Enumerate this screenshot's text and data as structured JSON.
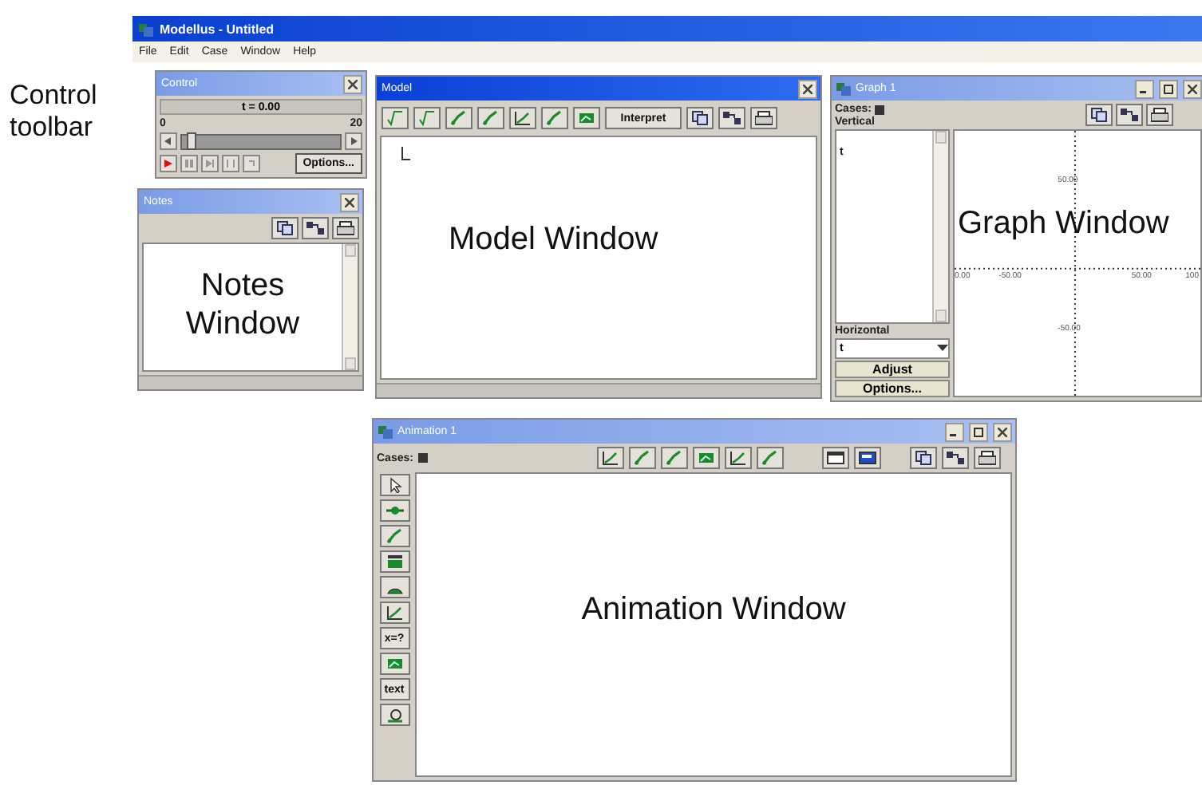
{
  "annotation": "Control toolbar",
  "app": {
    "title": "Modellus - Untitled",
    "menu": [
      "File",
      "Edit",
      "Case",
      "Window",
      "Help"
    ]
  },
  "control": {
    "title": "Control",
    "active": false,
    "readout": "t = 0.00",
    "slider": {
      "min": "0",
      "max": "20",
      "level": 0.03
    },
    "options": "Options..."
  },
  "notes": {
    "title": "Notes",
    "active": false,
    "caption": "Notes Window"
  },
  "model": {
    "title": "Model",
    "active": true,
    "interpret": "Interpret",
    "caption": "Model Window"
  },
  "graph": {
    "title": "Graph 1",
    "active": false,
    "cases": "Cases:",
    "vertical": "Vertical",
    "vertical_items": [
      "t"
    ],
    "horizontal": "Horizontal",
    "horizontal_value": "t",
    "adjust": "Adjust",
    "options": "Options...",
    "caption": "Graph Window",
    "y_ticks": [
      "50.00",
      "-50.00"
    ],
    "x_ticks": [
      "0.00",
      "-50.00",
      "50.00",
      "100"
    ]
  },
  "animation": {
    "title": "Animation 1",
    "active": false,
    "cases": "Cases:",
    "tools": [
      {
        "kind": "icon"
      },
      {
        "kind": "icon"
      },
      {
        "kind": "icon"
      },
      {
        "kind": "icon"
      },
      {
        "kind": "icon"
      },
      {
        "kind": "icon"
      },
      {
        "kind": "label",
        "label": "x=?"
      },
      {
        "kind": "icon"
      },
      {
        "kind": "label",
        "label": "text"
      },
      {
        "kind": "icon"
      }
    ],
    "caption": "Animation Window"
  }
}
